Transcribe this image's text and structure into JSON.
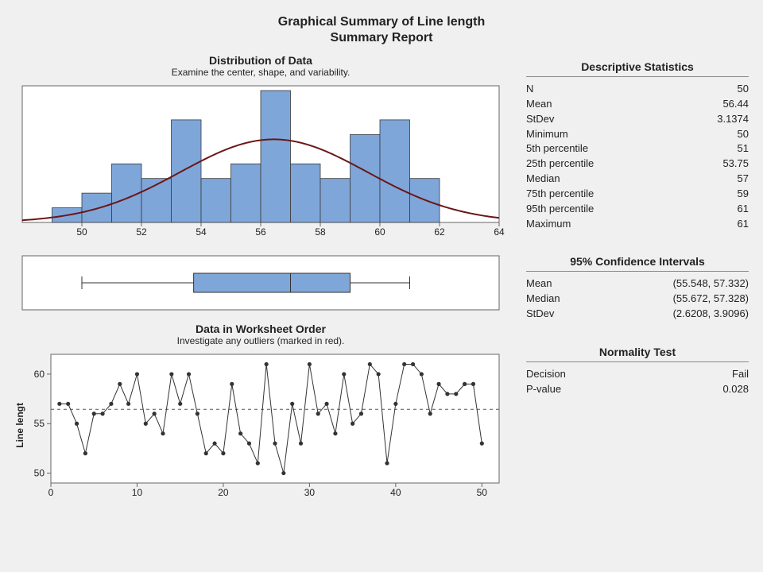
{
  "title_line1": "Graphical Summary of Line length",
  "title_line2": "Summary Report",
  "dist_title": "Distribution of Data",
  "dist_sub": "Examine the center, shape, and variability.",
  "order_title": "Data in Worksheet Order",
  "order_sub": "Investigate any outliers (marked in red).",
  "order_ylabel": "Line lengt",
  "desc_title": "Descriptive Statistics",
  "ci_title": "95% Confidence Intervals",
  "norm_title": "Normality Test",
  "desc": [
    {
      "k": "N",
      "v": "50"
    },
    {
      "k": "Mean",
      "v": "56.44"
    },
    {
      "k": "StDev",
      "v": "3.1374"
    },
    {
      "k": "Minimum",
      "v": "50"
    },
    {
      "k": "5th percentile",
      "v": "51"
    },
    {
      "k": "25th percentile",
      "v": "53.75"
    },
    {
      "k": "Median",
      "v": "57"
    },
    {
      "k": "75th percentile",
      "v": "59"
    },
    {
      "k": "95th percentile",
      "v": "61"
    },
    {
      "k": "Maximum",
      "v": "61"
    }
  ],
  "ci": [
    {
      "k": "Mean",
      "v": "(55.548, 57.332)"
    },
    {
      "k": "Median",
      "v": "(55.672, 57.328)"
    },
    {
      "k": "StDev",
      "v": "(2.6208, 3.9096)"
    }
  ],
  "norm": [
    {
      "k": "Decision",
      "v": "Fail"
    },
    {
      "k": "P-value",
      "v": "0.028"
    }
  ],
  "chart_data": [
    {
      "id": "histogram",
      "type": "bar",
      "title": "Distribution of Data",
      "xlabel": "",
      "ylabel": "",
      "xlim": [
        48,
        64
      ],
      "ylim": [
        0,
        9
      ],
      "bin_width": 1,
      "categories": [
        49,
        50,
        51,
        52,
        53,
        54,
        55,
        56,
        57,
        58,
        59,
        60,
        61
      ],
      "values": [
        1,
        2,
        4,
        3,
        7,
        3,
        4,
        9,
        4,
        3,
        6,
        7,
        3
      ],
      "overlay": {
        "type": "normal_curve",
        "mean": 56.44,
        "sd": 3.1374
      },
      "x_ticks": [
        50,
        52,
        54,
        56,
        58,
        60,
        62,
        64
      ]
    },
    {
      "id": "boxplot",
      "type": "box",
      "xlim": [
        48,
        64
      ],
      "min": 50,
      "q1": 53.75,
      "median": 57,
      "q3": 59,
      "max": 61
    },
    {
      "id": "run_chart",
      "type": "line",
      "title": "Data in Worksheet Order",
      "xlabel": "",
      "ylabel": "Line lengt",
      "xlim": [
        0,
        52
      ],
      "ylim": [
        49,
        62
      ],
      "x_ticks": [
        0,
        10,
        20,
        30,
        40,
        50
      ],
      "y_ticks": [
        50,
        55,
        60
      ],
      "ref_line": 56.44,
      "x": [
        1,
        2,
        3,
        4,
        5,
        6,
        7,
        8,
        9,
        10,
        11,
        12,
        13,
        14,
        15,
        16,
        17,
        18,
        19,
        20,
        21,
        22,
        23,
        24,
        25,
        26,
        27,
        28,
        29,
        30,
        31,
        32,
        33,
        34,
        35,
        36,
        37,
        38,
        39,
        40,
        41,
        42,
        43,
        44,
        45,
        46,
        47,
        48,
        49,
        50
      ],
      "y": [
        57,
        57,
        55,
        52,
        56,
        56,
        57,
        59,
        57,
        60,
        55,
        56,
        54,
        60,
        57,
        60,
        56,
        52,
        53,
        52,
        59,
        54,
        53,
        51,
        61,
        53,
        50,
        57,
        53,
        61,
        56,
        57,
        54,
        60,
        55,
        56,
        61,
        60,
        51,
        57,
        61,
        61,
        60,
        56,
        59,
        58,
        58,
        59,
        59,
        53
      ]
    }
  ]
}
